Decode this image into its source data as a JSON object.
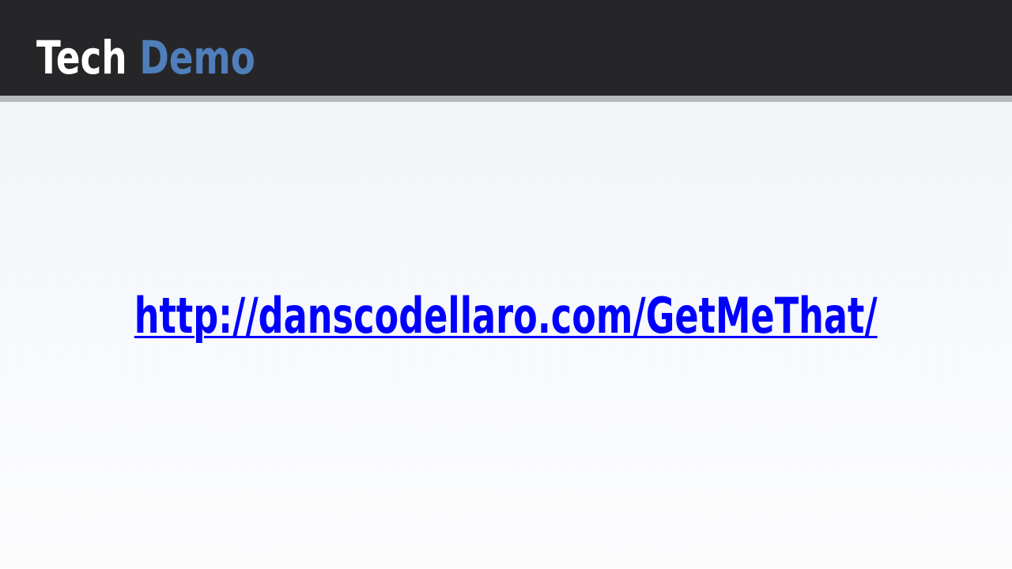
{
  "header": {
    "title_word_1": "Tech",
    "title_word_2": "Demo"
  },
  "main": {
    "link_text": "http://danscodellaro.com/GetMeThat/"
  },
  "colors": {
    "header_bg": "#262629",
    "header_rule": "#b7b8bb",
    "title_primary": "#ffffff",
    "title_accent": "#4f7ebb",
    "link": "#0000ff",
    "page_bg": "#f4f6fa"
  }
}
